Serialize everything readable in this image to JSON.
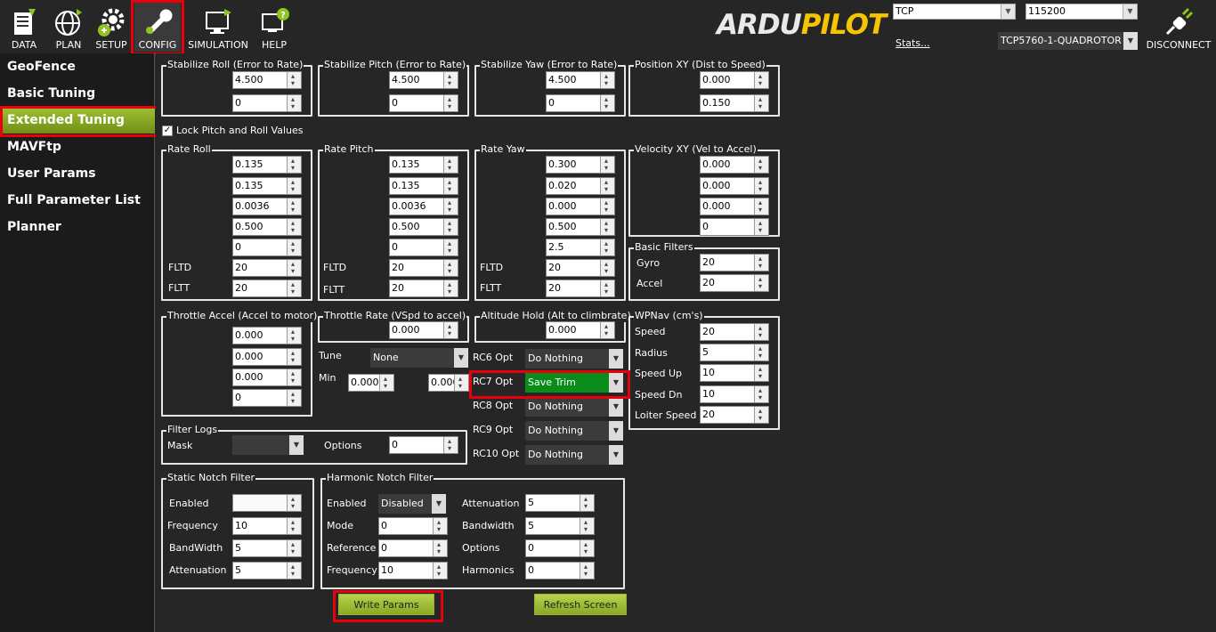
{
  "menu": {
    "items": [
      {
        "key": "data",
        "label": "DATA",
        "icon": "data-icon"
      },
      {
        "key": "plan",
        "label": "PLAN",
        "icon": "globe-icon"
      },
      {
        "key": "setup",
        "label": "SETUP",
        "icon": "gear-icon"
      },
      {
        "key": "config",
        "label": "CONFIG",
        "icon": "wrench-icon"
      },
      {
        "key": "simulation",
        "label": "SIMULATION",
        "icon": "simulation-icon"
      },
      {
        "key": "help",
        "label": "HELP",
        "icon": "help-icon"
      }
    ],
    "active": "config"
  },
  "logo": {
    "part1": "ARDU",
    "part2": "PILOT"
  },
  "connection": {
    "type": "TCP",
    "baud": "115200",
    "stats": "Stats...",
    "device": "TCP5760-1-QUADROTOR",
    "disconnect": "DISCONNECT"
  },
  "sidebar": {
    "items": [
      "GeoFence",
      "Basic Tuning",
      "Extended Tuning",
      "MAVFtp",
      "User Params",
      "Full Parameter List",
      "Planner"
    ],
    "selected": "Extended Tuning"
  },
  "groups": {
    "stab_roll": {
      "title": "Stabilize Roll (Error to Rate)",
      "values": [
        "4.500",
        "0"
      ]
    },
    "stab_pitch": {
      "title": "Stabilize Pitch (Error to Rate)",
      "values": [
        "4.500",
        "0"
      ]
    },
    "stab_yaw": {
      "title": "Stabilize Yaw (Error to Rate)",
      "values": [
        "4.500",
        "0"
      ]
    },
    "pos_xy": {
      "title": "Position XY (Dist to Speed)",
      "values": [
        "0.000",
        "0.150"
      ]
    },
    "lock": {
      "label": "Lock Pitch and Roll Values",
      "checked": true
    },
    "rate_roll": {
      "title": "Rate Roll",
      "values": [
        "0.135",
        "0.135",
        "0.0036",
        "0.500",
        "0",
        "20",
        "20"
      ],
      "fltd": "FLTD",
      "fltt": "FLTT"
    },
    "rate_pitch": {
      "title": "Rate Pitch",
      "values": [
        "0.135",
        "0.135",
        "0.0036",
        "0.500",
        "0",
        "20",
        "20"
      ],
      "fltd": "FLTD",
      "fltt": "FLTT"
    },
    "rate_yaw": {
      "title": "Rate Yaw",
      "values": [
        "0.300",
        "0.020",
        "0.000",
        "0.500",
        "2.5",
        "20",
        "20"
      ],
      "fltd": "FLTD",
      "fltt": "FLTT"
    },
    "vel_xy": {
      "title": "Velocity XY (Vel to Accel)",
      "values": [
        "0.000",
        "0.000",
        "0.000",
        "0"
      ]
    },
    "basic_filters": {
      "title": "Basic Filters",
      "gyro_label": "Gyro",
      "gyro": "20",
      "accel_label": "Accel",
      "accel": "20"
    },
    "throttle_accel": {
      "title": "Throttle Accel (Accel to motor)",
      "values": [
        "0.000",
        "0.000",
        "0.000",
        "0"
      ]
    },
    "throttle_rate": {
      "title": "Throttle Rate (VSpd to accel)",
      "value": "0.000"
    },
    "alt_hold": {
      "title": "Altitude Hold (Alt to climbrate)",
      "value": "0.000"
    },
    "tune": {
      "label": "Tune",
      "value": "None",
      "min_label": "Min",
      "min": "0.000",
      "max": "0.000"
    },
    "rc": [
      {
        "label": "RC6 Opt",
        "value": "Do Nothing"
      },
      {
        "label": "RC7 Opt",
        "value": "Save Trim"
      },
      {
        "label": "RC8 Opt",
        "value": "Do Nothing"
      },
      {
        "label": "RC9 Opt",
        "value": "Do Nothing"
      },
      {
        "label": "RC10 Opt",
        "value": "Do Nothing"
      }
    ],
    "wpnav": {
      "title": "WPNav (cm's)",
      "rows": [
        {
          "label": "Speed",
          "value": "20"
        },
        {
          "label": "Radius",
          "value": "5"
        },
        {
          "label": "Speed Up",
          "value": "10"
        },
        {
          "label": "Speed Dn",
          "value": "10"
        },
        {
          "label": "Loiter Speed",
          "value": "20"
        }
      ]
    },
    "filter_logs": {
      "title": "Filter Logs",
      "mask_label": "Mask",
      "options_label": "Options",
      "options": "0"
    },
    "static_notch": {
      "title": "Static Notch Filter",
      "rows": [
        {
          "label": "Enabled",
          "value": ""
        },
        {
          "label": "Frequency",
          "value": "10"
        },
        {
          "label": "BandWidth",
          "value": "5"
        },
        {
          "label": "Attenuation",
          "value": "5"
        }
      ]
    },
    "harmonic_notch": {
      "title": "Harmonic Notch Filter",
      "left": [
        {
          "label": "Enabled",
          "value": "Disabled"
        },
        {
          "label": "Mode",
          "value": "0"
        },
        {
          "label": "Reference",
          "value": "0"
        },
        {
          "label": "Frequency",
          "value": "10"
        }
      ],
      "right": [
        {
          "label": "Attenuation",
          "value": "5"
        },
        {
          "label": "Bandwidth",
          "value": "5"
        },
        {
          "label": "Options",
          "value": "0"
        },
        {
          "label": "Harmonics",
          "value": "0"
        }
      ]
    }
  },
  "buttons": {
    "write": "Write Params",
    "refresh": "Refresh Screen"
  }
}
